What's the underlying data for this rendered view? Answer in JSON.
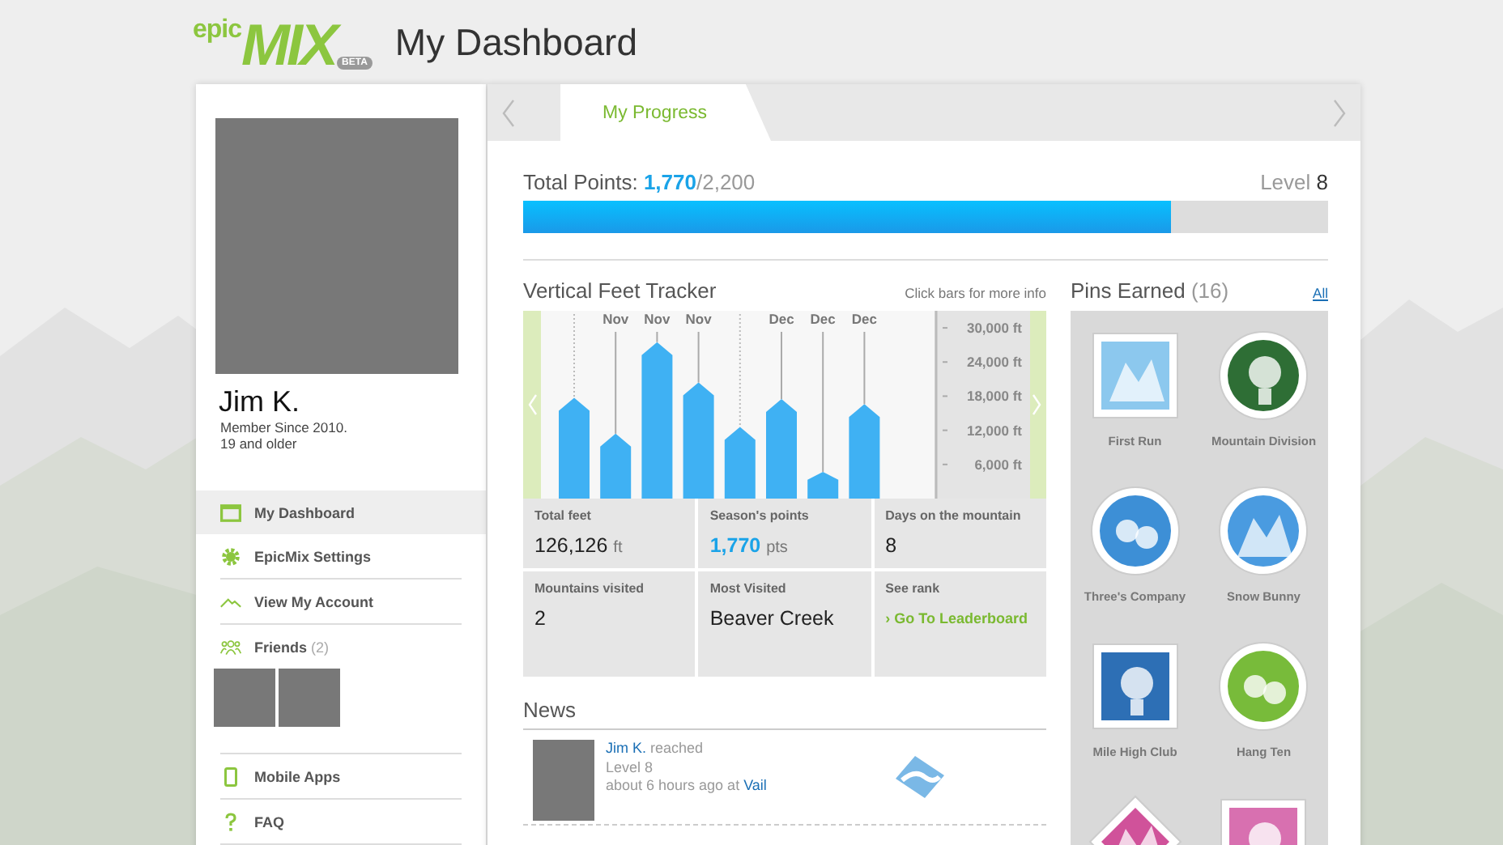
{
  "logo": {
    "small": "epic",
    "large": "MIX",
    "badge": "BETA"
  },
  "page_title": "My Dashboard",
  "profile": {
    "name": "Jim K.",
    "member_since": "Member Since 2010.",
    "age_group": "19 and older"
  },
  "sidebar": {
    "items": [
      {
        "label": "My Dashboard",
        "kind": "dashboard",
        "selected": true
      },
      {
        "label": "EpicMix Settings",
        "kind": "settings",
        "selected": false
      },
      {
        "label": "View My Account",
        "kind": "account",
        "selected": false
      },
      {
        "label": "Friends",
        "count": "(2)",
        "kind": "friends",
        "selected": false
      },
      {
        "label": "Mobile Apps",
        "kind": "apps",
        "selected": false
      },
      {
        "label": "FAQ",
        "kind": "faq",
        "selected": false
      }
    ]
  },
  "tabs": [
    {
      "label": "My Progress",
      "selected": true
    }
  ],
  "progress": {
    "label": "Total Points:",
    "points": "1,770",
    "goal": "/2,200",
    "level_label": "Level",
    "level_value": "8",
    "level": 0.805
  },
  "tracker": {
    "title": "Vertical Feet Tracker",
    "hint": "Click bars for more info",
    "chart_data": {
      "type": "bar",
      "categories": [
        null,
        "Nov",
        "Nov",
        "Nov",
        null,
        "Dec",
        "Dec",
        "Dec"
      ],
      "series": [
        {
          "color": "#3fb1f3",
          "values": [
            17700,
            11400,
            27500,
            20400,
            12600,
            17500,
            4700,
            16600
          ]
        }
      ],
      "ylim": [
        0,
        33000
      ],
      "yticks": [
        {
          "value": 6000,
          "label": "6,000 ft"
        },
        {
          "value": 12000,
          "label": "12,000 ft"
        },
        {
          "value": 18000,
          "label": "18,000 ft"
        },
        {
          "value": 24000,
          "label": "24,000 ft"
        },
        {
          "value": 30000,
          "label": "30,000 ft"
        }
      ]
    }
  },
  "stats": [
    {
      "label": "Total feet",
      "value": "126,126",
      "unit": "ft",
      "kind": "plain"
    },
    {
      "label": "Season's points",
      "value": "1,770",
      "unit": "pts",
      "kind": "points"
    },
    {
      "label": "Days on the mountain",
      "value": "8",
      "kind": "plain"
    },
    {
      "label": "Mountains visited",
      "value": "2",
      "kind": "plain"
    },
    {
      "label": "Most Visited",
      "value": "Beaver Creek",
      "kind": "plain"
    },
    {
      "label": "See rank",
      "value": "› Go To Leaderboard",
      "kind": "link"
    }
  ],
  "news": {
    "title": "News",
    "items": [
      {
        "user": "Jim K.",
        "action": "reached",
        "detail": "Level 8",
        "time": "about 6 hours ago at",
        "place": "Vail"
      }
    ]
  },
  "pins": {
    "title": "Pins Earned",
    "count": "(16)",
    "all_link": "All",
    "items": [
      {
        "label": "First Run",
        "kind": "square",
        "color": "#8cc8ee"
      },
      {
        "label": "Mountain Division",
        "kind": "round",
        "color": "#2e6e35"
      },
      {
        "label": "Three's Company",
        "kind": "round",
        "color": "#3d8fd6"
      },
      {
        "label": "Snow Bunny",
        "kind": "round",
        "color": "#4a9be0"
      },
      {
        "label": "Mile High Club",
        "kind": "square",
        "color": "#2d6fb5"
      },
      {
        "label": "Hang Ten",
        "kind": "round",
        "color": "#78bb3a"
      },
      {
        "kind": "diamond",
        "color": "#d0529a"
      },
      {
        "kind": "square",
        "color": "#d870b0"
      }
    ]
  }
}
